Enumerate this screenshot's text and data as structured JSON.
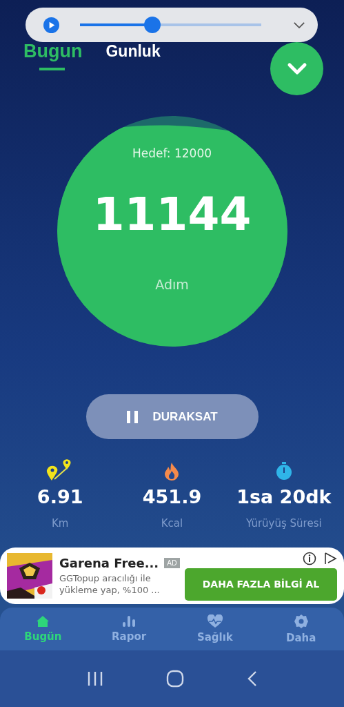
{
  "media_player": {
    "level": 0.4
  },
  "tabs": [
    {
      "label": "Bugun",
      "selected": true
    },
    {
      "label": "Gunluk",
      "selected": false
    }
  ],
  "goal": {
    "label": "Hedef: 12000",
    "steps": "11144",
    "unit": "Adım"
  },
  "pause_button": {
    "label": "DURAKSAT"
  },
  "stats": [
    {
      "kind": "distance",
      "value": "6.91",
      "label": "Km"
    },
    {
      "kind": "calories",
      "value": "451.9",
      "label": "Kcal"
    },
    {
      "kind": "duration",
      "value": "1sa 20dk",
      "label": "Yürüyüş Süresi"
    }
  ],
  "ad": {
    "title": "Garena Free...",
    "badge": "AD",
    "text": "GGTopup aracılığı ile yükleme yap, %100 ...",
    "button": "DAHA FAZLA BİLGİ AL"
  },
  "bottom_nav": [
    {
      "kind": "home",
      "label": "Bugün",
      "selected": true
    },
    {
      "kind": "report",
      "label": "Rapor",
      "selected": false
    },
    {
      "kind": "health",
      "label": "Sağlık",
      "selected": false
    },
    {
      "kind": "more",
      "label": "Daha",
      "selected": false
    }
  ]
}
